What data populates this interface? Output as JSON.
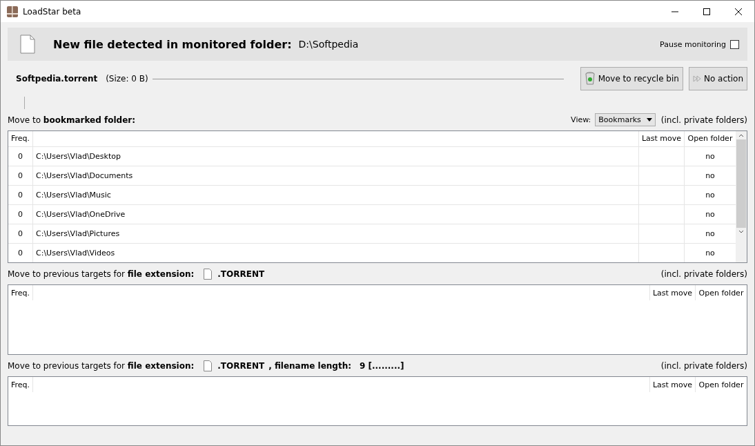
{
  "window": {
    "title": "LoadStar beta"
  },
  "header": {
    "title": "New file detected in monitored folder:",
    "folder": "D:\\Softpedia",
    "pause": {
      "label": "Pause monitoring",
      "checked": false
    }
  },
  "file": {
    "name": "Softpedia.torrent",
    "size": "(Size: 0 B)"
  },
  "buttons": [
    {
      "label": "Move to recycle bin",
      "kind": "recycle"
    },
    {
      "label": "No action",
      "kind": "skip"
    }
  ],
  "bookmarks": {
    "label": "Move to **bookmarked folder:**",
    "view_label": "View:",
    "view_value": "Bookmarks",
    "note": "(incl. private folders)",
    "columns": [
      "Freq.",
      "Last move",
      "Open folder"
    ],
    "rows": [
      {
        "freq": "0",
        "path": "C:\\Users\\Vlad\\Desktop",
        "open_folder": "no"
      },
      {
        "freq": "0",
        "path": "C:\\Users\\Vlad\\Documents",
        "open_folder": "no"
      },
      {
        "freq": "0",
        "path": "C:\\Users\\Vlad\\Music",
        "open_folder": "no"
      },
      {
        "freq": "0",
        "path": "C:\\Users\\Vlad\\OneDrive",
        "open_folder": "no"
      },
      {
        "freq": "0",
        "path": "C:\\Users\\Vlad\\Pictures",
        "open_folder": "no"
      },
      {
        "freq": "0",
        "path": "C:\\Users\\Vlad\\Videos",
        "open_folder": "no"
      }
    ]
  },
  "sections": [
    {
      "label": "Move to previous targets for **file extension:**",
      "extension": ".TORRENT",
      "note": "(incl. private folders)",
      "columns": [
        "Freq.",
        "Last move",
        "Open folder"
      ]
    },
    {
      "label": "Move to previous targets for **file extension:**",
      "extension": ".TORRENT",
      "extra": ", filename length:",
      "length": "9 [.........]",
      "note": "(incl. private folders)",
      "columns": [
        "Freq.",
        "Last move",
        "Open folder"
      ]
    }
  ]
}
